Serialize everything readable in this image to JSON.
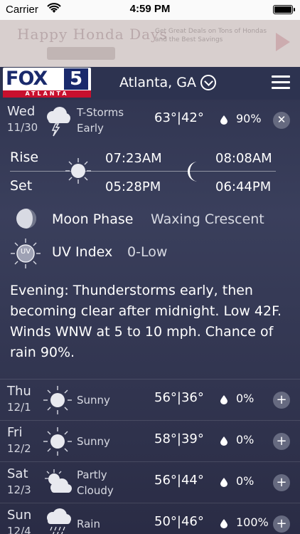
{
  "status_bar": {
    "carrier": "Carrier",
    "time": "4:59 PM"
  },
  "ad": {
    "title": "Happy Honda Days",
    "copy": "Get Great Deals on Tons of Hondas and the Best Savings"
  },
  "header": {
    "logo_main": "FOX",
    "logo_number": "5",
    "logo_city": "ATLANTA",
    "location": "Atlanta, GA"
  },
  "today": {
    "day": "Wed",
    "date": "11/30",
    "condition_line1": "T-Storms",
    "condition_line2": "Early",
    "temps": "63°|42°",
    "precip": "90%",
    "icon": "thunderstorm-icon"
  },
  "detail": {
    "rise_label": "Rise",
    "set_label": "Set",
    "sunrise": "07:23AM",
    "sunset": "05:28PM",
    "moonrise": "08:08AM",
    "moonset": "06:44PM",
    "moon_phase_label": "Moon Phase",
    "moon_phase_value": "Waxing Crescent",
    "uv_label": "UV Index",
    "uv_value": "0-Low",
    "uv_icon_text": "UV",
    "description": "Evening: Thunderstorms early, then becoming clear after midnight. Low 42F. Winds WNW at 5 to 10 mph. Chance of rain 90%."
  },
  "forecast": [
    {
      "day": "Thu",
      "date": "12/1",
      "condition_line1": "Sunny",
      "condition_line2": "",
      "temps": "56°|36°",
      "precip": "0%",
      "icon": "sunny-icon"
    },
    {
      "day": "Fri",
      "date": "12/2",
      "condition_line1": "Sunny",
      "condition_line2": "",
      "temps": "58°|39°",
      "precip": "0%",
      "icon": "sunny-icon"
    },
    {
      "day": "Sat",
      "date": "12/3",
      "condition_line1": "Partly",
      "condition_line2": "Cloudy",
      "temps": "56°|44°",
      "precip": "0%",
      "icon": "partly-cloudy-icon"
    },
    {
      "day": "Sun",
      "date": "12/4",
      "condition_line1": "Rain",
      "condition_line2": "",
      "temps": "50°|46°",
      "precip": "100%",
      "icon": "rain-icon"
    }
  ],
  "colors": {
    "header_bg": "#2d3350",
    "logo_blue": "#1a2a6c",
    "logo_red": "#c8102e"
  }
}
